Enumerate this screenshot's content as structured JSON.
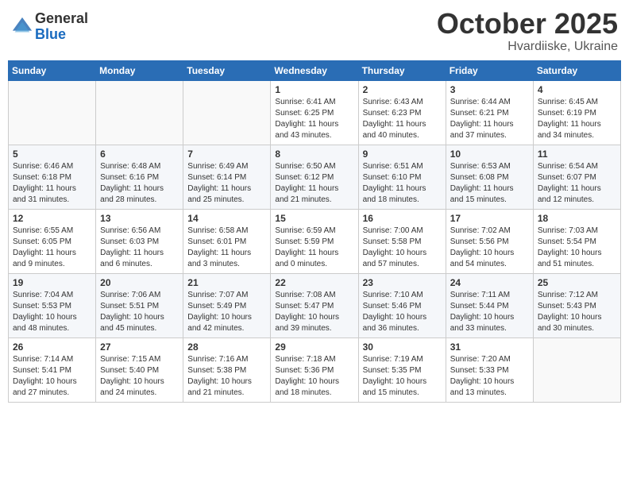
{
  "header": {
    "logo_general": "General",
    "logo_blue": "Blue",
    "month": "October 2025",
    "location": "Hvardiiske, Ukraine"
  },
  "weekdays": [
    "Sunday",
    "Monday",
    "Tuesday",
    "Wednesday",
    "Thursday",
    "Friday",
    "Saturday"
  ],
  "weeks": [
    [
      {
        "day": "",
        "info": ""
      },
      {
        "day": "",
        "info": ""
      },
      {
        "day": "",
        "info": ""
      },
      {
        "day": "1",
        "info": "Sunrise: 6:41 AM\nSunset: 6:25 PM\nDaylight: 11 hours\nand 43 minutes."
      },
      {
        "day": "2",
        "info": "Sunrise: 6:43 AM\nSunset: 6:23 PM\nDaylight: 11 hours\nand 40 minutes."
      },
      {
        "day": "3",
        "info": "Sunrise: 6:44 AM\nSunset: 6:21 PM\nDaylight: 11 hours\nand 37 minutes."
      },
      {
        "day": "4",
        "info": "Sunrise: 6:45 AM\nSunset: 6:19 PM\nDaylight: 11 hours\nand 34 minutes."
      }
    ],
    [
      {
        "day": "5",
        "info": "Sunrise: 6:46 AM\nSunset: 6:18 PM\nDaylight: 11 hours\nand 31 minutes."
      },
      {
        "day": "6",
        "info": "Sunrise: 6:48 AM\nSunset: 6:16 PM\nDaylight: 11 hours\nand 28 minutes."
      },
      {
        "day": "7",
        "info": "Sunrise: 6:49 AM\nSunset: 6:14 PM\nDaylight: 11 hours\nand 25 minutes."
      },
      {
        "day": "8",
        "info": "Sunrise: 6:50 AM\nSunset: 6:12 PM\nDaylight: 11 hours\nand 21 minutes."
      },
      {
        "day": "9",
        "info": "Sunrise: 6:51 AM\nSunset: 6:10 PM\nDaylight: 11 hours\nand 18 minutes."
      },
      {
        "day": "10",
        "info": "Sunrise: 6:53 AM\nSunset: 6:08 PM\nDaylight: 11 hours\nand 15 minutes."
      },
      {
        "day": "11",
        "info": "Sunrise: 6:54 AM\nSunset: 6:07 PM\nDaylight: 11 hours\nand 12 minutes."
      }
    ],
    [
      {
        "day": "12",
        "info": "Sunrise: 6:55 AM\nSunset: 6:05 PM\nDaylight: 11 hours\nand 9 minutes."
      },
      {
        "day": "13",
        "info": "Sunrise: 6:56 AM\nSunset: 6:03 PM\nDaylight: 11 hours\nand 6 minutes."
      },
      {
        "day": "14",
        "info": "Sunrise: 6:58 AM\nSunset: 6:01 PM\nDaylight: 11 hours\nand 3 minutes."
      },
      {
        "day": "15",
        "info": "Sunrise: 6:59 AM\nSunset: 5:59 PM\nDaylight: 11 hours\nand 0 minutes."
      },
      {
        "day": "16",
        "info": "Sunrise: 7:00 AM\nSunset: 5:58 PM\nDaylight: 10 hours\nand 57 minutes."
      },
      {
        "day": "17",
        "info": "Sunrise: 7:02 AM\nSunset: 5:56 PM\nDaylight: 10 hours\nand 54 minutes."
      },
      {
        "day": "18",
        "info": "Sunrise: 7:03 AM\nSunset: 5:54 PM\nDaylight: 10 hours\nand 51 minutes."
      }
    ],
    [
      {
        "day": "19",
        "info": "Sunrise: 7:04 AM\nSunset: 5:53 PM\nDaylight: 10 hours\nand 48 minutes."
      },
      {
        "day": "20",
        "info": "Sunrise: 7:06 AM\nSunset: 5:51 PM\nDaylight: 10 hours\nand 45 minutes."
      },
      {
        "day": "21",
        "info": "Sunrise: 7:07 AM\nSunset: 5:49 PM\nDaylight: 10 hours\nand 42 minutes."
      },
      {
        "day": "22",
        "info": "Sunrise: 7:08 AM\nSunset: 5:47 PM\nDaylight: 10 hours\nand 39 minutes."
      },
      {
        "day": "23",
        "info": "Sunrise: 7:10 AM\nSunset: 5:46 PM\nDaylight: 10 hours\nand 36 minutes."
      },
      {
        "day": "24",
        "info": "Sunrise: 7:11 AM\nSunset: 5:44 PM\nDaylight: 10 hours\nand 33 minutes."
      },
      {
        "day": "25",
        "info": "Sunrise: 7:12 AM\nSunset: 5:43 PM\nDaylight: 10 hours\nand 30 minutes."
      }
    ],
    [
      {
        "day": "26",
        "info": "Sunrise: 7:14 AM\nSunset: 5:41 PM\nDaylight: 10 hours\nand 27 minutes."
      },
      {
        "day": "27",
        "info": "Sunrise: 7:15 AM\nSunset: 5:40 PM\nDaylight: 10 hours\nand 24 minutes."
      },
      {
        "day": "28",
        "info": "Sunrise: 7:16 AM\nSunset: 5:38 PM\nDaylight: 10 hours\nand 21 minutes."
      },
      {
        "day": "29",
        "info": "Sunrise: 7:18 AM\nSunset: 5:36 PM\nDaylight: 10 hours\nand 18 minutes."
      },
      {
        "day": "30",
        "info": "Sunrise: 7:19 AM\nSunset: 5:35 PM\nDaylight: 10 hours\nand 15 minutes."
      },
      {
        "day": "31",
        "info": "Sunrise: 7:20 AM\nSunset: 5:33 PM\nDaylight: 10 hours\nand 13 minutes."
      },
      {
        "day": "",
        "info": ""
      }
    ]
  ]
}
